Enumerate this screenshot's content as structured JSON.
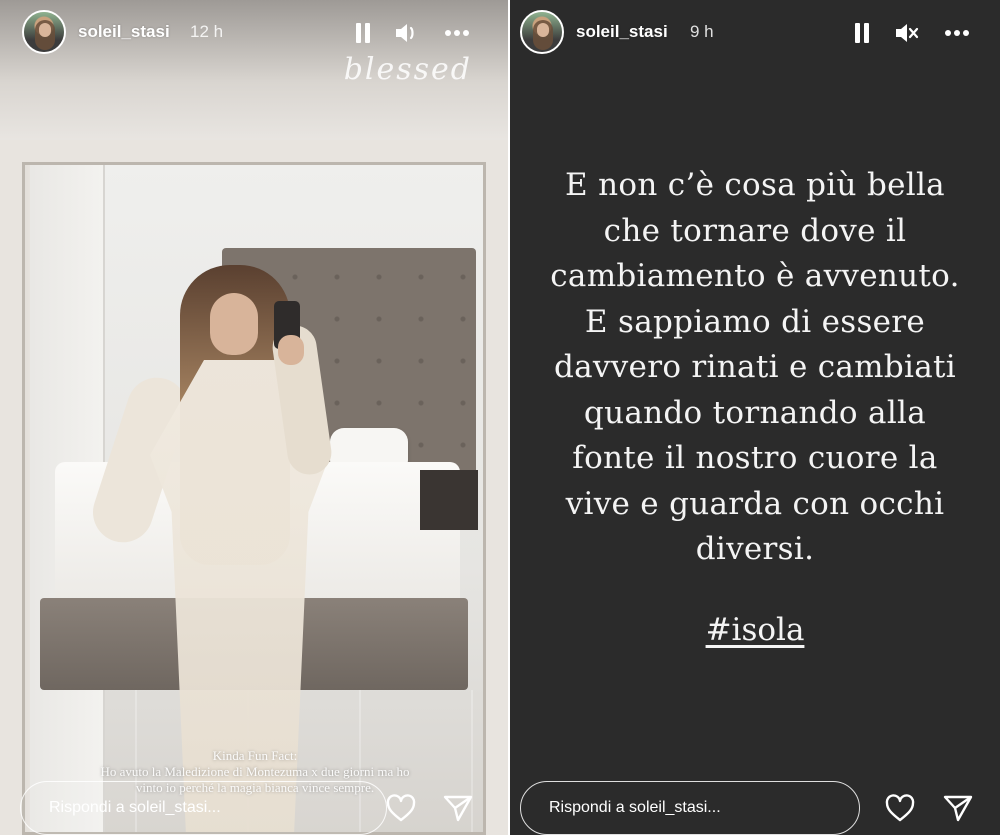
{
  "left_story": {
    "username": "soleil_stasi",
    "time": "12 h",
    "sticker_text": "blessed",
    "caption_lines": [
      "Kinda Fun Fact:",
      "Ho avuto la Maledizione di Montezuma x due giorni ma ho",
      "vinto io perché la magia bianca vince sempre."
    ],
    "reply_placeholder": "Rispondi a soleil_stasi..."
  },
  "right_story": {
    "username": "soleil_stasi",
    "time": "9 h",
    "text_lines": [
      "E non c’è cosa più bella",
      "che tornare dove il",
      "cambiamento è avvenuto.",
      "E sappiamo di essere",
      "davvero rinati e cambiati",
      "quando tornando alla",
      "fonte il nostro cuore la",
      "vive e guarda con occhi",
      "diversi."
    ],
    "hashtag": "#isola",
    "reply_placeholder": "Rispondi a soleil_stasi..."
  },
  "icons": {
    "pause": "pause-icon",
    "sound_on": "volume-icon",
    "sound_muted": "volume-muted-icon",
    "more": "more-icon",
    "like": "heart-icon",
    "share": "send-icon"
  },
  "colors": {
    "right_background": "#2b2b2b",
    "text": "#ffffff"
  }
}
